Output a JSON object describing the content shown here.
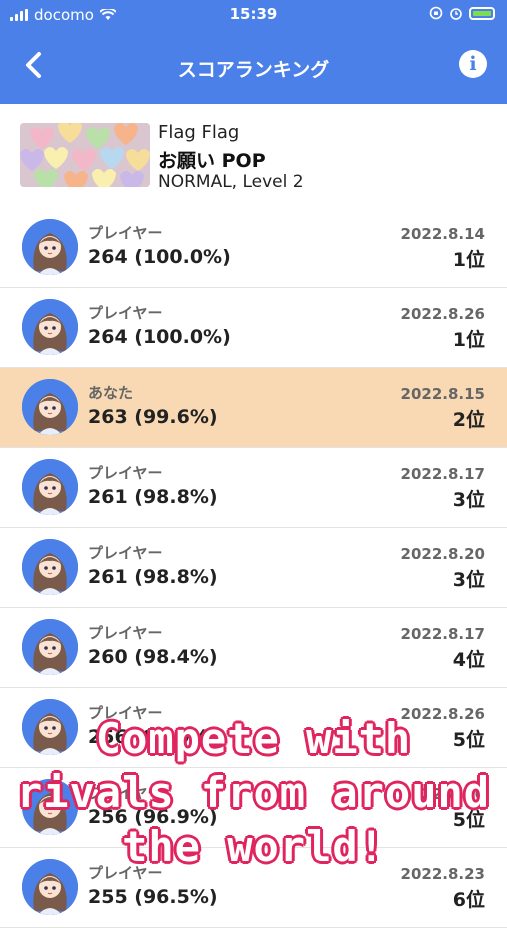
{
  "status_bar": {
    "carrier": "docomo",
    "time": "15:39"
  },
  "header": {
    "title": "スコアランキング",
    "back_label": "‹",
    "info_label": "i"
  },
  "song": {
    "artist": "Flag Flag",
    "title": "お願い POP",
    "difficulty": "NORMAL, Level 2"
  },
  "rankings": [
    {
      "name": "プレイヤー",
      "score": "264 (100.0%)",
      "date": "2022.8.14",
      "rank": "1位",
      "highlight": false
    },
    {
      "name": "プレイヤー",
      "score": "264 (100.0%)",
      "date": "2022.8.26",
      "rank": "1位",
      "highlight": false
    },
    {
      "name": "あなた",
      "score": "263 (99.6%)",
      "date": "2022.8.15",
      "rank": "2位",
      "highlight": true
    },
    {
      "name": "プレイヤー",
      "score": "261 (98.8%)",
      "date": "2022.8.17",
      "rank": "3位",
      "highlight": false
    },
    {
      "name": "プレイヤー",
      "score": "261 (98.8%)",
      "date": "2022.8.20",
      "rank": "3位",
      "highlight": false
    },
    {
      "name": "プレイヤー",
      "score": "260 (98.4%)",
      "date": "2022.8.17",
      "rank": "4位",
      "highlight": false
    },
    {
      "name": "プレイヤー",
      "score": "256 (96.9%)",
      "date": "2022.8.26",
      "rank": "5位",
      "highlight": false
    },
    {
      "name": "プレイヤー",
      "score": "256 (96.9%)",
      "date": "2022.8.26",
      "rank": "5位",
      "highlight": false
    },
    {
      "name": "プレイヤー",
      "score": "255 (96.5%)",
      "date": "2022.8.23",
      "rank": "6位",
      "highlight": false
    }
  ],
  "promo": {
    "lines": [
      "Compete with",
      "rivals from around",
      "the world!"
    ]
  },
  "colors": {
    "header": "#4a80e8",
    "highlight_row": "#f9d9b3",
    "promo_outline": "#e0245e"
  }
}
